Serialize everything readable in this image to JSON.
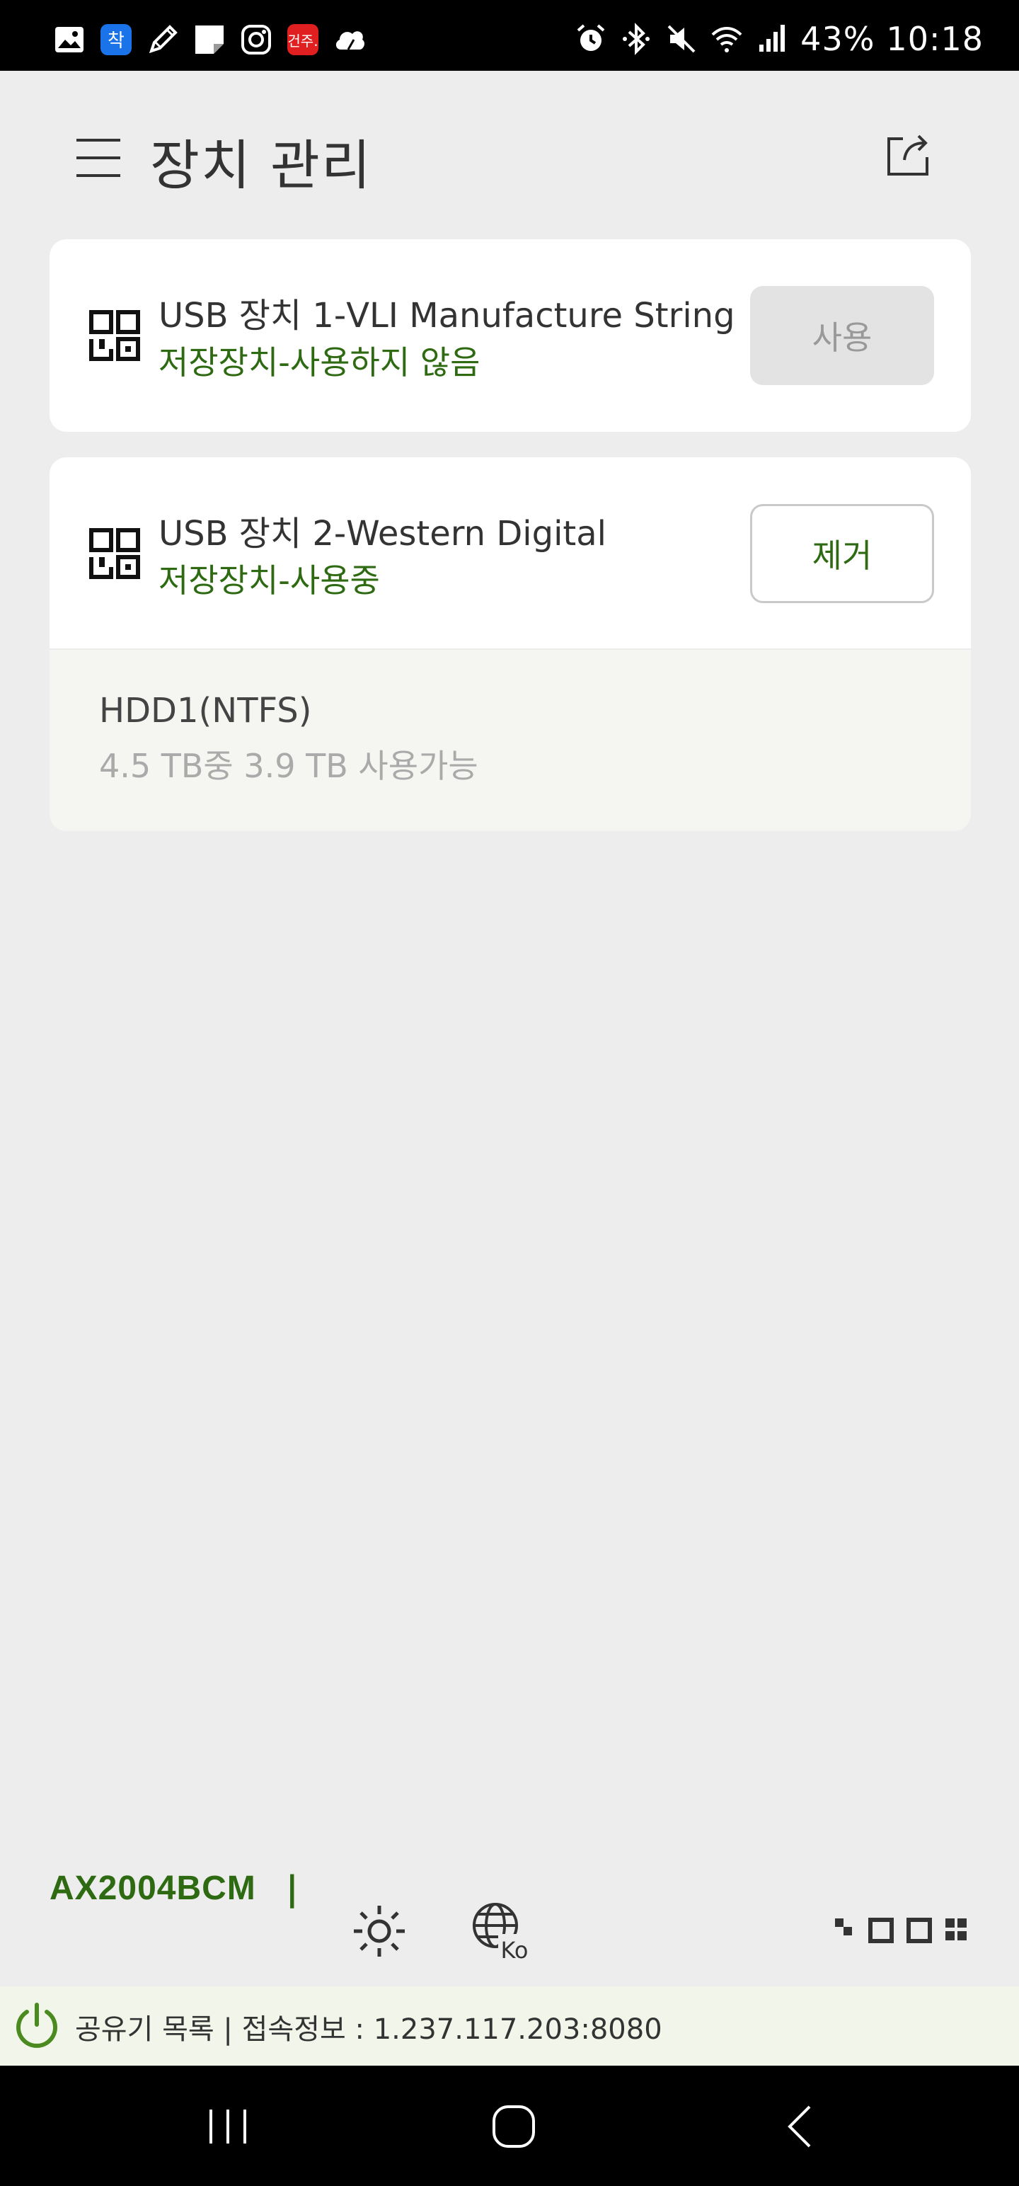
{
  "status_bar": {
    "battery": "43%",
    "time": "10:18",
    "notification_icons": [
      "gallery-icon",
      "app-icon",
      "pen-icon",
      "note-icon",
      "instagram-icon",
      "news-app-icon",
      "cloud-icon"
    ],
    "system_icons": [
      "alarm-icon",
      "bluetooth-icon",
      "mute-icon",
      "wifi-icon",
      "signal-icon"
    ]
  },
  "header": {
    "title": "장치 관리",
    "menu_icon": "hamburger-icon",
    "export_icon": "export-icon"
  },
  "devices": [
    {
      "name": "USB 장치 1-VLI Manufacture String",
      "status": "저장장치-사용하지 않음",
      "action_label": "사용",
      "action_enabled": false
    },
    {
      "name": "USB 장치 2-Western Digital",
      "status": "저장장치-사용중",
      "action_label": "제거",
      "action_enabled": true,
      "partition": {
        "name": "HDD1(NTFS)",
        "usage": "4.5 TB중 3.9 TB 사용가능"
      }
    }
  ],
  "toolbar": {
    "model": "AX2004BCM",
    "separator": "|",
    "icons": [
      "brightness-icon",
      "language-icon",
      "layout-icon"
    ]
  },
  "info_bar": {
    "text": "공유기 목록 | 접속정보 : 1.237.117.203:8080"
  },
  "colors": {
    "accent_green": "#2e6a12",
    "background": "#ededed",
    "card": "#ffffff",
    "disabled_button": "#e3e3e3"
  }
}
